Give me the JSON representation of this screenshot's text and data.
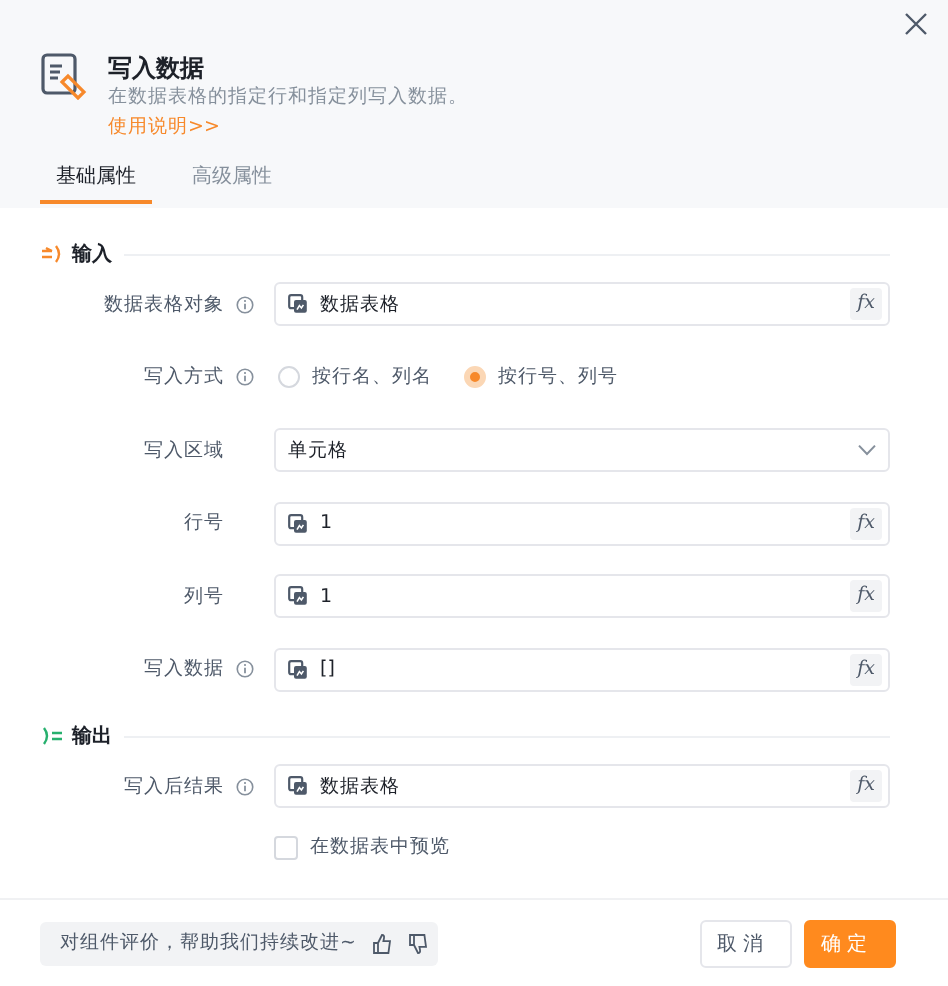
{
  "header": {
    "title": "写入数据",
    "description": "在数据表格的指定行和指定列写入数据。",
    "help_link": "使用说明>>"
  },
  "tabs": [
    {
      "label": "基础属性",
      "selected": true
    },
    {
      "label": "高级属性",
      "selected": false
    }
  ],
  "sections": [
    {
      "title": "输入",
      "kind": "input",
      "fields": [
        {
          "kind": "variable",
          "label": "数据表格对象",
          "info": true,
          "value": "数据表格",
          "formula": "fx"
        },
        {
          "kind": "radio",
          "label": "写入方式",
          "info": true,
          "options": [
            {
              "label": "按行名、列名",
              "selected": false
            },
            {
              "label": "按行号、列号",
              "selected": true
            }
          ]
        },
        {
          "kind": "select",
          "label": "写入区域",
          "info": false,
          "value": "单元格"
        },
        {
          "kind": "variable",
          "label": "行号",
          "info": false,
          "value": "1",
          "formula": "fx"
        },
        {
          "kind": "variable",
          "label": "列号",
          "info": false,
          "value": "1",
          "formula": "fx"
        },
        {
          "kind": "variable",
          "label": "写入数据",
          "info": true,
          "value": "[]",
          "formula": "fx"
        }
      ]
    },
    {
      "title": "输出",
      "kind": "output",
      "fields": [
        {
          "kind": "variable",
          "label": "写入后结果",
          "info": true,
          "value": "数据表格",
          "formula": "fx"
        },
        {
          "kind": "checkbox",
          "label": "在数据表中预览",
          "checked": false
        }
      ]
    }
  ],
  "footer": {
    "feedback": "对组件评价，帮助我们持续改进~",
    "buttons": [
      {
        "label": "取消",
        "kind": "secondary"
      },
      {
        "label": "确定",
        "kind": "primary"
      }
    ]
  }
}
